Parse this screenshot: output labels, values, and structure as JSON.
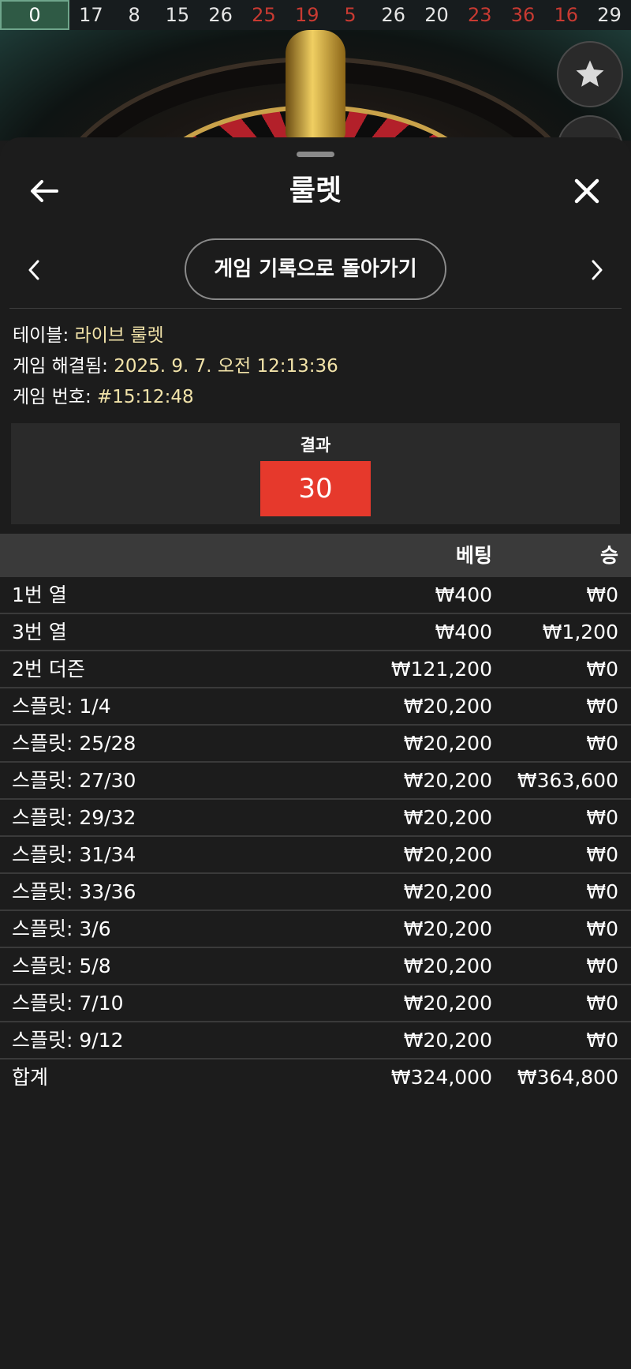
{
  "history": [
    {
      "num": "0",
      "color": "green"
    },
    {
      "num": "17",
      "color": "black"
    },
    {
      "num": "8",
      "color": "black"
    },
    {
      "num": "15",
      "color": "black"
    },
    {
      "num": "26",
      "color": "black"
    },
    {
      "num": "25",
      "color": "red"
    },
    {
      "num": "19",
      "color": "red"
    },
    {
      "num": "5",
      "color": "red"
    },
    {
      "num": "26",
      "color": "black"
    },
    {
      "num": "20",
      "color": "black"
    },
    {
      "num": "23",
      "color": "red"
    },
    {
      "num": "36",
      "color": "red"
    },
    {
      "num": "16",
      "color": "red"
    },
    {
      "num": "29",
      "color": "black"
    }
  ],
  "icons": {
    "favorite": "star-icon",
    "back": "arrow-left-icon",
    "close": "close-icon",
    "prev": "chevron-left-icon",
    "next": "chevron-right-icon"
  },
  "colors": {
    "result_red": "#e6392c",
    "history_red": "#c83a32",
    "info_value": "#f2e3a9"
  },
  "sheet": {
    "title": "룰렛",
    "history_button": "게임 기록으로 돌아가기"
  },
  "info": {
    "table_label": "테이블:",
    "table_value": "라이브 룰렛",
    "resolved_label": "게임 해결됨:",
    "resolved_value": "2025. 9. 7. 오전 12:13:36",
    "game_no_label": "게임 번호:",
    "game_no_value": "#15:12:48"
  },
  "result": {
    "label": "결과",
    "value": "30"
  },
  "table": {
    "headers": {
      "bet": "베팅",
      "win": "승"
    },
    "rows": [
      {
        "name": "1번 열",
        "bet": "₩400",
        "win": "₩0"
      },
      {
        "name": "3번 열",
        "bet": "₩400",
        "win": "₩1,200"
      },
      {
        "name": "2번 더즌",
        "bet": "₩121,200",
        "win": "₩0"
      },
      {
        "name": "스플릿: 1/4",
        "bet": "₩20,200",
        "win": "₩0"
      },
      {
        "name": "스플릿: 25/28",
        "bet": "₩20,200",
        "win": "₩0"
      },
      {
        "name": "스플릿: 27/30",
        "bet": "₩20,200",
        "win": "₩363,600"
      },
      {
        "name": "스플릿: 29/32",
        "bet": "₩20,200",
        "win": "₩0"
      },
      {
        "name": "스플릿: 31/34",
        "bet": "₩20,200",
        "win": "₩0"
      },
      {
        "name": "스플릿: 33/36",
        "bet": "₩20,200",
        "win": "₩0"
      },
      {
        "name": "스플릿: 3/6",
        "bet": "₩20,200",
        "win": "₩0"
      },
      {
        "name": "스플릿: 5/8",
        "bet": "₩20,200",
        "win": "₩0"
      },
      {
        "name": "스플릿: 7/10",
        "bet": "₩20,200",
        "win": "₩0"
      },
      {
        "name": "스플릿: 9/12",
        "bet": "₩20,200",
        "win": "₩0"
      }
    ],
    "total": {
      "name": "합계",
      "bet": "₩324,000",
      "win": "₩364,800"
    }
  }
}
